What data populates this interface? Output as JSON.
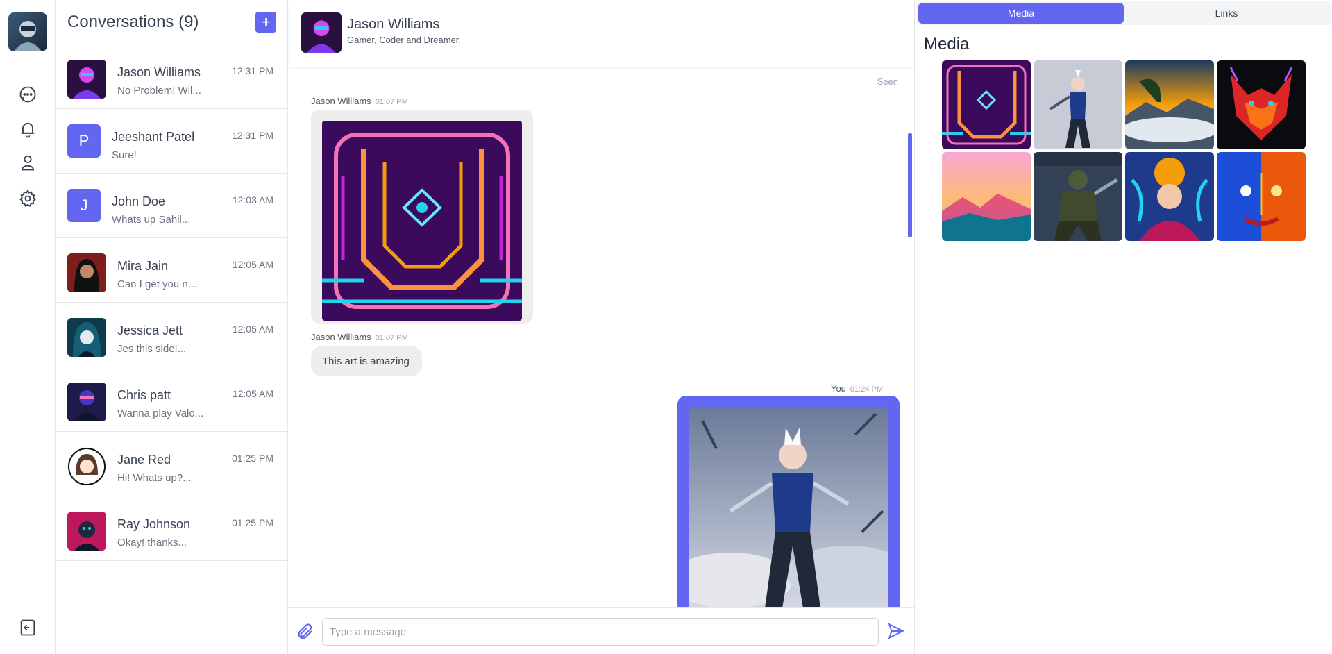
{
  "conversations_panel": {
    "title": "Conversations (9)",
    "add_label": "+",
    "items": [
      {
        "name": "Jason Williams",
        "preview": "No Problem! Wil...",
        "time": "12:31 PM",
        "avatar": "image",
        "letter": ""
      },
      {
        "name": "Jeeshant Patel",
        "preview": "Sure!",
        "time": "12:31 PM",
        "avatar": "letter",
        "letter": "P"
      },
      {
        "name": "John Doe",
        "preview": "Whats up Sahil...",
        "time": "12:03 AM",
        "avatar": "letter",
        "letter": "J"
      },
      {
        "name": "Mira Jain",
        "preview": "Can I get you n...",
        "time": "12:05 AM",
        "avatar": "image",
        "letter": ""
      },
      {
        "name": "Jessica Jett",
        "preview": "Jes this side!...",
        "time": "12:05 AM",
        "avatar": "image",
        "letter": ""
      },
      {
        "name": "Chris patt",
        "preview": "Wanna play Valo...",
        "time": "12:05 AM",
        "avatar": "image",
        "letter": ""
      },
      {
        "name": "Jane Red",
        "preview": "Hi! Whats up?...",
        "time": "01:25 PM",
        "avatar": "image",
        "letter": ""
      },
      {
        "name": "Ray Johnson",
        "preview": "Okay! thanks...",
        "time": "01:25 PM",
        "avatar": "image",
        "letter": ""
      }
    ]
  },
  "chat": {
    "contact_name": "Jason Williams",
    "contact_status": "Gamer, Coder and Dreamer.",
    "seen_label": "Seen",
    "messages": [
      {
        "sender": "Jason Williams",
        "time": "01:07 PM",
        "kind": "image",
        "text": ""
      },
      {
        "sender": "Jason Williams",
        "time": "01:07 PM",
        "kind": "text",
        "text": "This art is amazing"
      },
      {
        "sender": "You",
        "time": "01:24 PM",
        "kind": "image",
        "text": ""
      }
    ],
    "composer_placeholder": "Type a message"
  },
  "side_panel": {
    "tabs": [
      "Media",
      "Links"
    ],
    "active_tab": "Media",
    "title": "Media",
    "media_count": 8
  },
  "colors": {
    "accent": "#6366f1",
    "bubble_in": "#eeeeef",
    "border": "#e5e7eb"
  },
  "icons": [
    "chat-icon",
    "bell-icon",
    "user-icon",
    "settings-icon",
    "logout-icon",
    "attach-icon",
    "send-icon"
  ]
}
